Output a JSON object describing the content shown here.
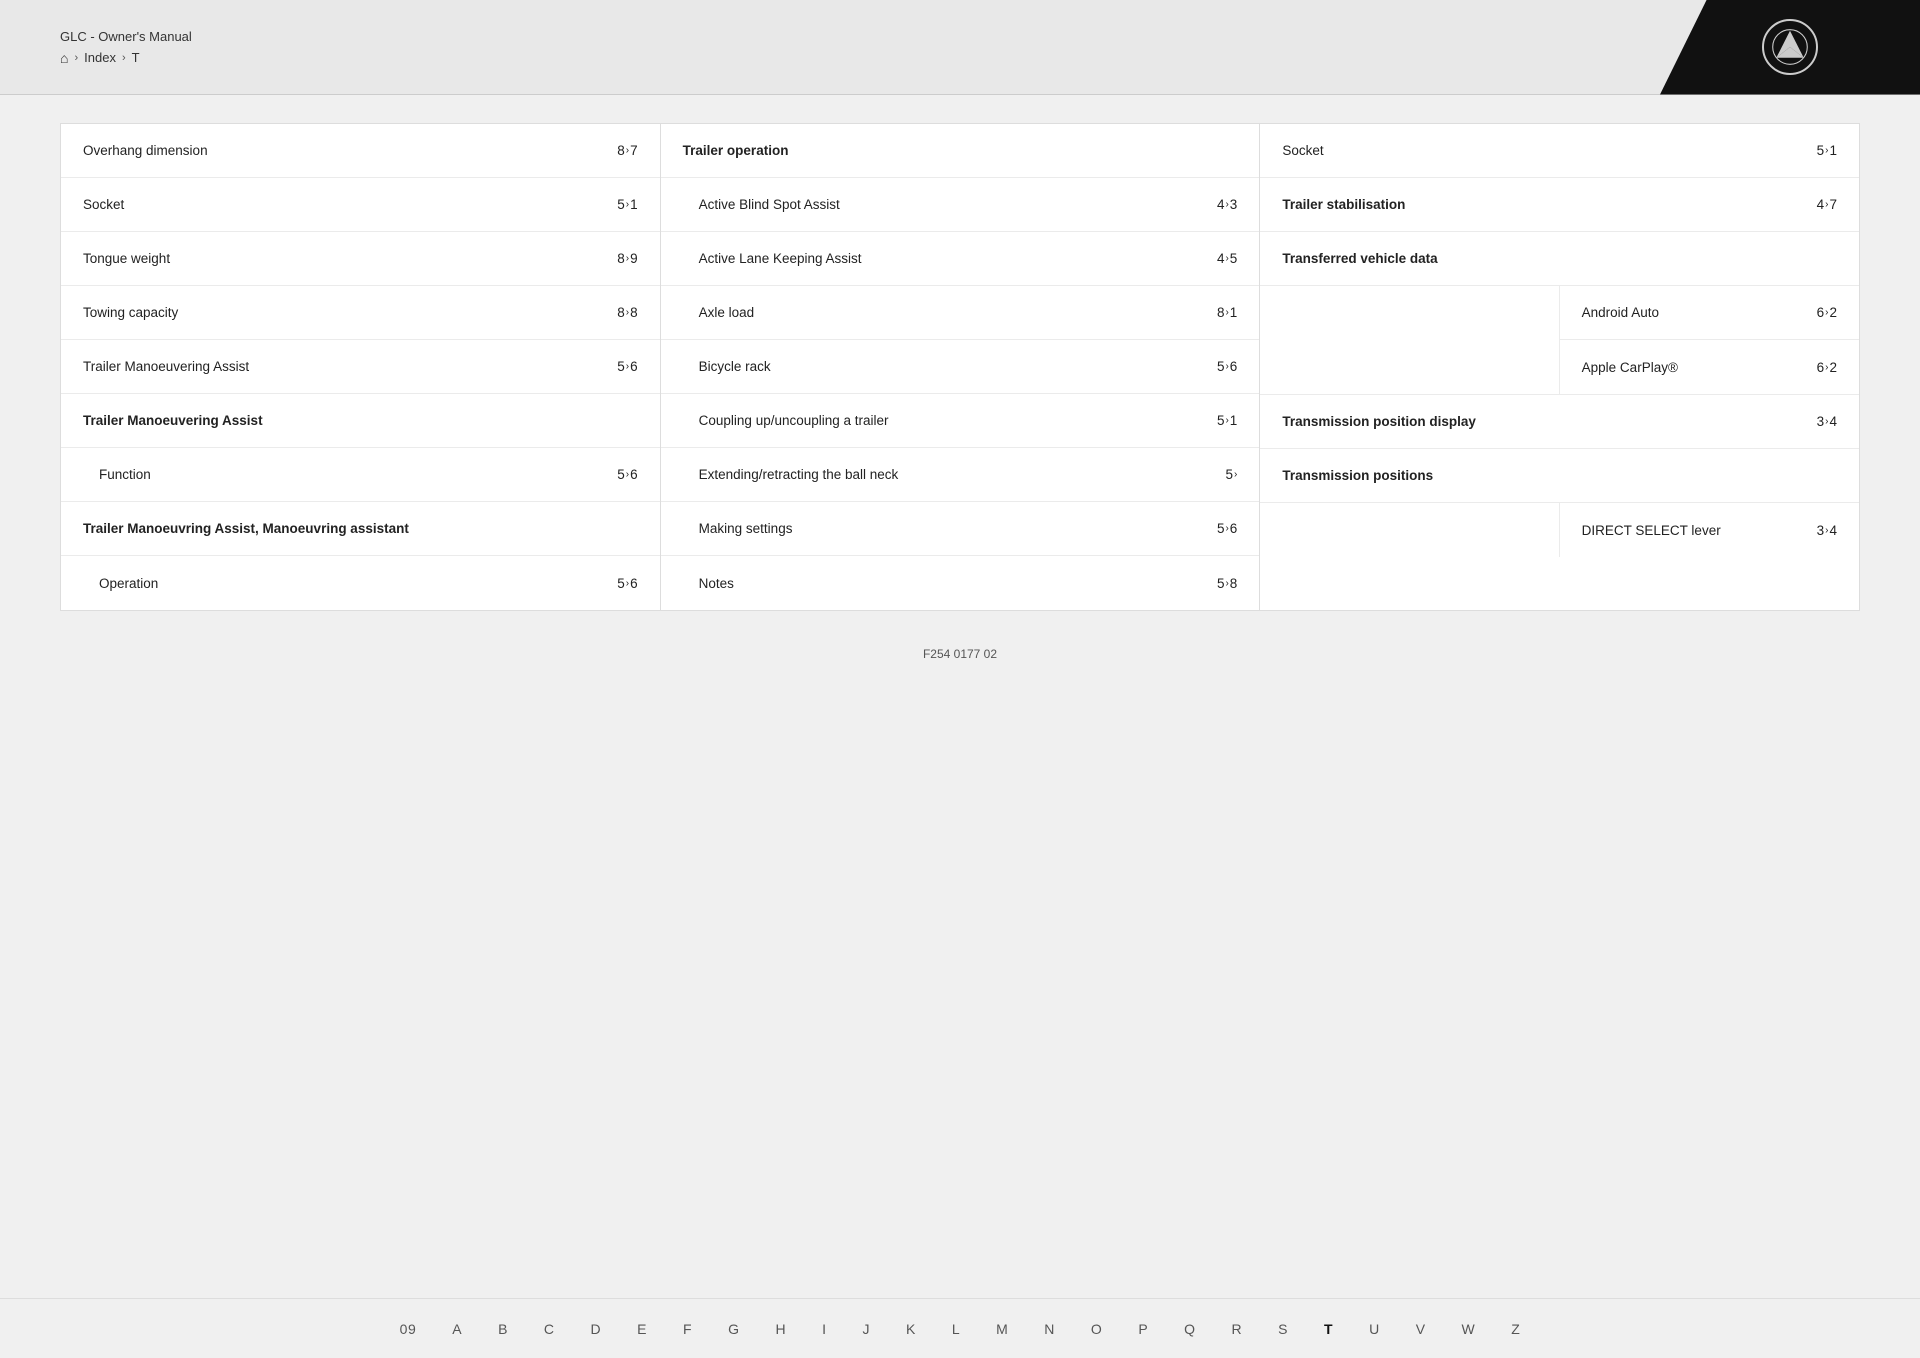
{
  "header": {
    "title": "GLC - Owner's Manual",
    "breadcrumb": [
      "Index",
      "T"
    ],
    "logo_alt": "Mercedes-Benz"
  },
  "col1": {
    "entries": [
      {
        "label": "Overhang dimension",
        "page": "8",
        "sub": "7"
      },
      {
        "label": "Socket",
        "page": "5",
        "sub": "1"
      },
      {
        "label": "Tongue weight",
        "page": "8",
        "sub": "9"
      },
      {
        "label": "Towing capacity",
        "page": "8",
        "sub": "8"
      },
      {
        "label": "Trailer Manoeuvering Assist",
        "page": "5",
        "sub": "6"
      }
    ],
    "sections": [
      {
        "header": "Trailer Manoeuvering Assist",
        "items": [
          {
            "label": "Function",
            "page": "5",
            "sub": "6"
          }
        ]
      },
      {
        "header": "Trailer Manoeuvring Assist, Manoeuvring assistant",
        "items": [
          {
            "label": "Operation",
            "page": "5",
            "sub": "6"
          }
        ]
      }
    ]
  },
  "col2": {
    "header": "Trailer operation",
    "entries": [
      {
        "label": "Active Blind Spot Assist",
        "page": "4",
        "sub": "3"
      },
      {
        "label": "Active Lane Keeping Assist",
        "page": "4",
        "sub": "5"
      },
      {
        "label": "Axle load",
        "page": "8",
        "sub": "1"
      },
      {
        "label": "Bicycle rack",
        "page": "5",
        "sub": "6"
      },
      {
        "label": "Coupling up/uncoupling a trailer",
        "page": "5",
        "sub": "1"
      },
      {
        "label": "Extending/retracting the ball neck",
        "page": "5",
        "sub": ""
      },
      {
        "label": "Making settings",
        "page": "5",
        "sub": "6"
      },
      {
        "label": "Notes",
        "page": "5",
        "sub": "8"
      }
    ]
  },
  "col3": {
    "top_entry": {
      "label": "Socket",
      "page": "5",
      "sub": "1"
    },
    "sections": [
      {
        "header": "Trailer stabilisation",
        "page": "4",
        "sub": "7",
        "is_header_with_page": true
      },
      {
        "header": "Transferred vehicle data",
        "items": [
          {
            "label": "Android Auto",
            "page": "6",
            "sub": "2"
          },
          {
            "label": "Apple CarPlay®",
            "page": "6",
            "sub": "2"
          }
        ]
      },
      {
        "header": "Transmission position display",
        "page": "3",
        "sub": "4",
        "is_header_with_page": true
      },
      {
        "header": "Transmission positions",
        "items": [
          {
            "label": "DIRECT SELECT lever",
            "page": "3",
            "sub": "4"
          }
        ]
      }
    ]
  },
  "alpha_bar": [
    "09",
    "A",
    "B",
    "C",
    "D",
    "E",
    "F",
    "G",
    "H",
    "I",
    "J",
    "K",
    "L",
    "M",
    "N",
    "O",
    "P",
    "Q",
    "R",
    "S",
    "T",
    "U",
    "V",
    "W",
    "Z"
  ],
  "active_alpha": "T",
  "doc_number": "F254 0177 02"
}
